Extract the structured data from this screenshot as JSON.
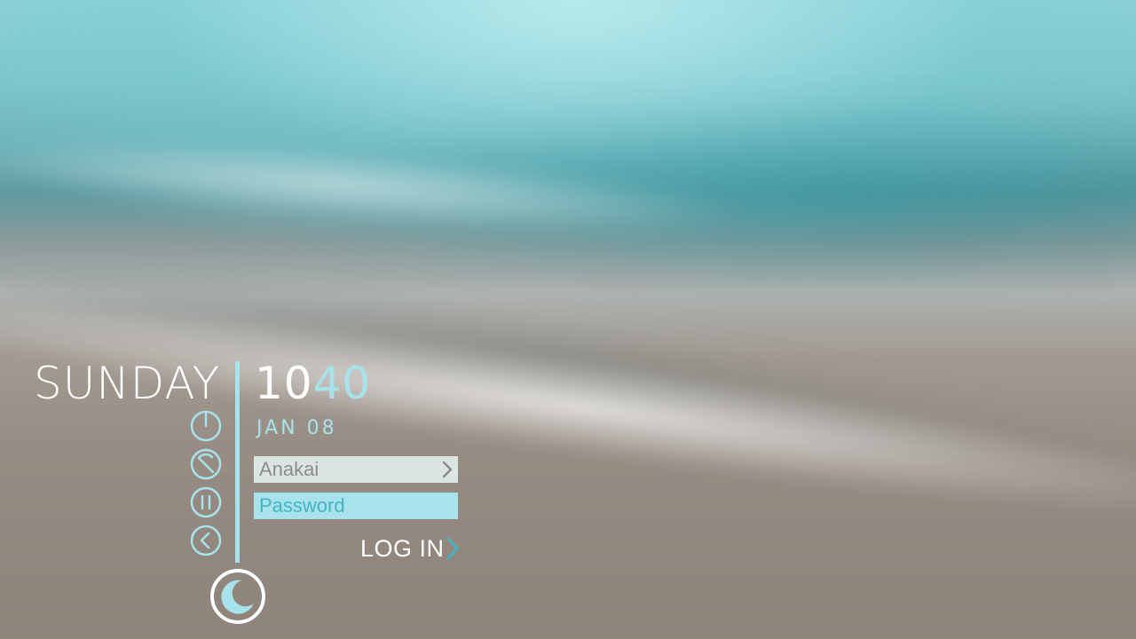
{
  "clock": {
    "day": "SUNDAY",
    "hours": "10",
    "minutes": "40",
    "date": "JAN 08"
  },
  "login": {
    "username": "Anakai",
    "password_placeholder": "Password",
    "login_label": "LOG IN"
  },
  "power_actions": [
    "power-icon",
    "restart-icon",
    "suspend-icon",
    "back-icon"
  ],
  "session_icon": "moon-icon",
  "colors": {
    "accent": "#a8e2ea",
    "accent_text": "#43b4c8",
    "text": "#ffffff",
    "username_field": "#e2eee8",
    "username_text": "#8c8c8c"
  }
}
